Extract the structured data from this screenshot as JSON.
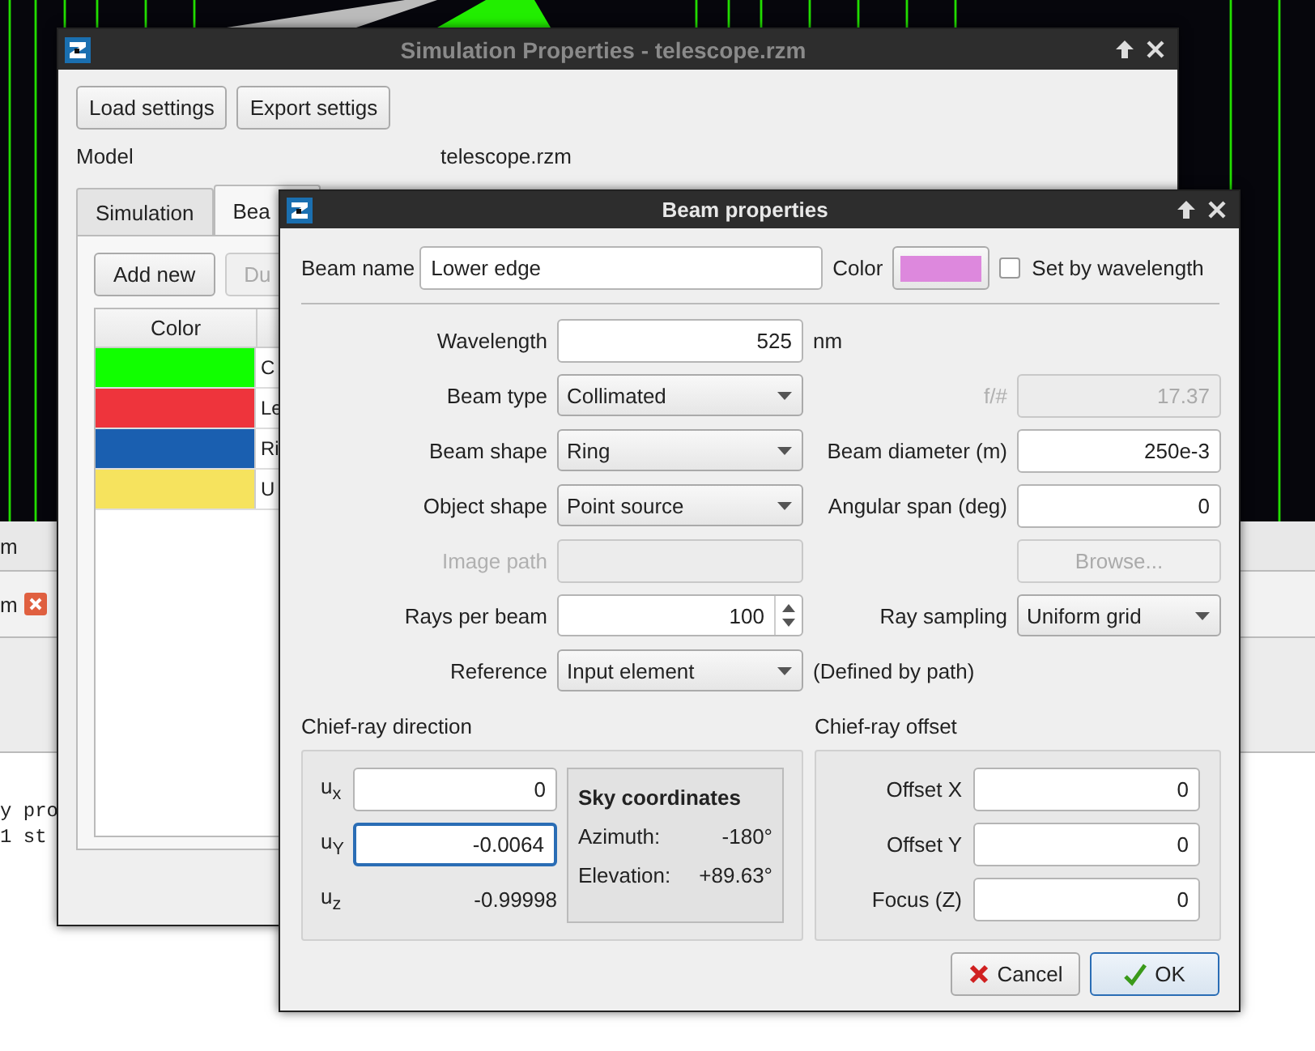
{
  "background": {
    "tab": {
      "label": "m"
    },
    "document_tab": {
      "label": "m"
    },
    "console_lines": [
      "y pro",
      "1 st"
    ]
  },
  "main_window": {
    "title": "Simulation Properties - telescope.rzm",
    "buttons": [
      "Load settings",
      "Export settigs"
    ],
    "model_label": "Model",
    "model_value": "telescope.rzm",
    "tabs": [
      {
        "label": "Simulation",
        "selected": false
      },
      {
        "label": "Bea",
        "selected": true
      }
    ],
    "tab_buttons": [
      {
        "label": "Add new",
        "disabled": false
      },
      {
        "label": "Du",
        "disabled": true
      }
    ],
    "table": {
      "columns": [
        "Color"
      ],
      "rows": [
        {
          "color": "#11ff00",
          "name": "C"
        },
        {
          "color": "#ee343c",
          "name": "Le"
        },
        {
          "color": "#1a5fb0",
          "name": "Ri"
        },
        {
          "color": "#f6e35e",
          "name": "U"
        }
      ]
    }
  },
  "beam_dialog": {
    "title": "Beam properties",
    "beam_name": {
      "label": "Beam name",
      "value": "Lower edge"
    },
    "color": {
      "label": "Color",
      "color": "#dd88dd"
    },
    "set_by_wavelength": {
      "label": "Set by wavelength",
      "checked": false
    },
    "rows": [
      {
        "label": "Wavelength",
        "disabled": false,
        "control": {
          "kind": "input",
          "value": "525"
        },
        "extra": {
          "kind": "unit",
          "text": "nm"
        }
      },
      {
        "label": "Beam type",
        "disabled": false,
        "control": {
          "kind": "dropdown",
          "value": "Collimated"
        },
        "extra": {
          "kind": "field",
          "label": "f/#",
          "value": "17.37",
          "disabled": true
        }
      },
      {
        "label": "Beam shape",
        "disabled": false,
        "control": {
          "kind": "dropdown",
          "value": "Ring"
        },
        "extra": {
          "kind": "field",
          "label": "Beam diameter (m)",
          "value": "250e-3",
          "disabled": false
        }
      },
      {
        "label": "Object shape",
        "disabled": false,
        "control": {
          "kind": "dropdown",
          "value": "Point source"
        },
        "extra": {
          "kind": "field",
          "label": "Angular span (deg)",
          "value": "0",
          "disabled": false
        }
      },
      {
        "label": "Image path",
        "disabled": true,
        "control": {
          "kind": "input"
        },
        "extra": {
          "kind": "button",
          "label": "Browse...",
          "disabled": true
        }
      },
      {
        "label": "Rays per beam",
        "disabled": false,
        "control": {
          "kind": "spinbox",
          "value": "100"
        },
        "extra": {
          "kind": "select",
          "label": "Ray sampling",
          "value": "Uniform grid"
        }
      },
      {
        "label": "Reference",
        "disabled": false,
        "control": {
          "kind": "dropdown",
          "value": "Input element"
        },
        "extra": {
          "kind": "note",
          "text": "(Defined by path)"
        }
      }
    ],
    "direction": {
      "title": "Chief-ray direction",
      "components": [
        {
          "label": "u$_{x}$",
          "kind": "input",
          "value": "0",
          "focused": false
        },
        {
          "label": "u$_{Y}$",
          "kind": "input",
          "value": "-0.0064",
          "focused": true
        },
        {
          "label": "u$_{z}$",
          "kind": "readout",
          "value": "-0.99998"
        }
      ],
      "sky": {
        "title": "Sky coordinates",
        "items": [
          {
            "label": "Azimuth:",
            "value": "-180°"
          },
          {
            "label": "Elevation:",
            "value": "+89.63°"
          }
        ]
      }
    },
    "offset": {
      "title": "Chief-ray offset",
      "fields": [
        {
          "label": "Offset X",
          "value": "0"
        },
        {
          "label": "Offset Y",
          "value": "0"
        },
        {
          "label": "Focus (Z)",
          "value": "0"
        }
      ]
    },
    "buttons": [
      {
        "label": "Cancel",
        "kind": "cancel",
        "default": false
      },
      {
        "label": "OK",
        "kind": "ok",
        "default": true
      }
    ]
  }
}
